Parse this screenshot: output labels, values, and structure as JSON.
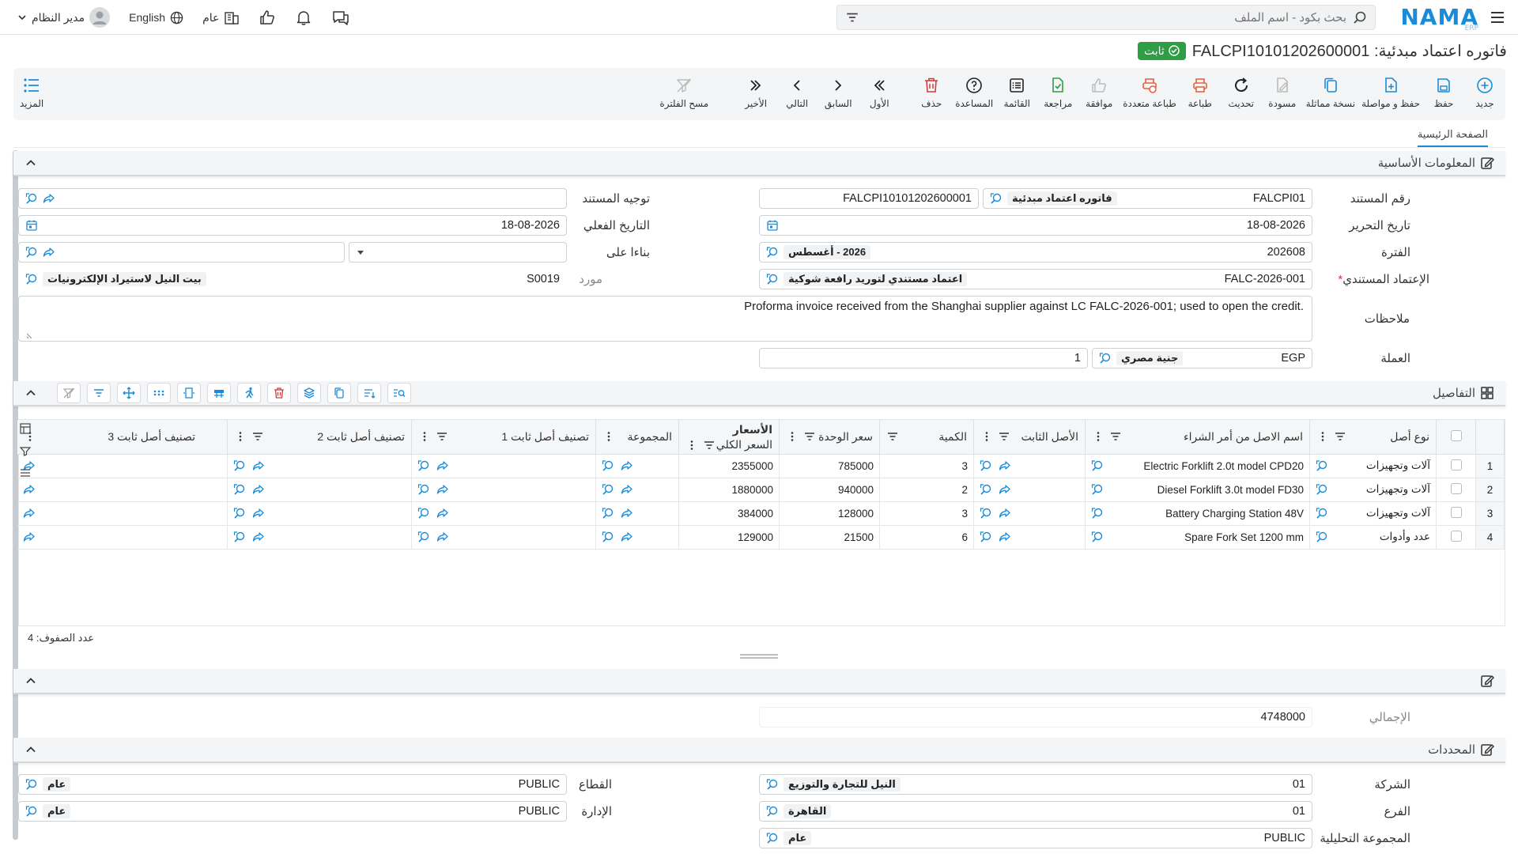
{
  "topbar": {
    "logo": "NAMA",
    "logo_sub": "ERP",
    "search_placeholder": "بحث بكود - اسم الملف",
    "user_name": "مدير النظام",
    "language": "English",
    "scope": "عام"
  },
  "title": {
    "text": "فاتوره اعتماد مبدئية: FALCPI10101202600001",
    "status": "ثابت"
  },
  "toolbar": [
    {
      "label": "جديد",
      "icon": "plus-circle-icon",
      "name": "new"
    },
    {
      "label": "حفظ",
      "icon": "save-icon",
      "name": "save"
    },
    {
      "label": "حفظ و مواصلة",
      "icon": "save-continue-icon",
      "name": "save-continue"
    },
    {
      "label": "نسخة مماثلة",
      "icon": "copy-icon",
      "name": "duplicate"
    },
    {
      "label": "مسودة",
      "icon": "draft-icon",
      "name": "draft"
    },
    {
      "label": "تحديث",
      "icon": "refresh-icon",
      "name": "refresh"
    },
    {
      "label": "طباعة",
      "icon": "print-icon",
      "name": "print"
    },
    {
      "label": "طباعة متعددة",
      "icon": "multi-print-icon",
      "name": "multi-print"
    },
    {
      "label": "موافقة",
      "icon": "thumbs-up-icon",
      "name": "approve"
    },
    {
      "label": "مراجعة",
      "icon": "review-icon",
      "name": "review"
    },
    {
      "label": "القائمة",
      "icon": "list-icon",
      "name": "list"
    },
    {
      "label": "المساعدة",
      "icon": "help-icon",
      "name": "help"
    },
    {
      "label": "حذف",
      "icon": "trash-icon",
      "name": "delete"
    },
    {
      "label": "الأول",
      "icon": "first-icon",
      "name": "first"
    },
    {
      "label": "السابق",
      "icon": "prev-icon",
      "name": "previous"
    },
    {
      "label": "التالي",
      "icon": "next-icon",
      "name": "next"
    },
    {
      "label": "الأخير",
      "icon": "last-icon",
      "name": "last"
    },
    {
      "label": "مسح الفلترة",
      "icon": "clear-filter-icon",
      "name": "clear-filter"
    }
  ],
  "toolbar_more": "المزيد",
  "tab": "الصفحة الرئيسية",
  "sections": {
    "basic": "المعلومات الأساسية",
    "details": "التفاصيل",
    "dimensions": "المحددات"
  },
  "form": {
    "doc_number_label": "رقم المستند",
    "doc_number": "FALCPI01",
    "doc_type_tag": "فاتوره اعتماد مبدئية",
    "doc_code": "FALCPI10101202600001",
    "doc_direction_label": "توجيه المستند",
    "edit_date_label": "تاريخ التحرير",
    "edit_date": "18-08-2026",
    "actual_date_label": "التاريخ الفعلي",
    "actual_date": "18-08-2026",
    "period_label": "الفترة",
    "period": "202608",
    "period_tag": "2026 - أغسطس",
    "based_on_label": "بناءا على",
    "lc_label": "الإعتماد المستندي",
    "lc_value": "FALC-2026-001",
    "lc_tag": "اعتماد مستندي لتوريد رافعة شوكية",
    "supplier_label": "مورد",
    "supplier_code": "S0019",
    "supplier_tag": "بيت النيل لاستيراد الإلكترونيات",
    "notes_label": "ملاحظات",
    "notes": "Proforma invoice received from the Shanghai supplier against LC FALC-2026-001; used to open the credit.",
    "currency_label": "العملة",
    "currency": "EGP",
    "currency_tag": "جنية مصري",
    "rate": "1"
  },
  "grid": {
    "headers": {
      "asset_type": "نوع أصل",
      "po_asset_name": "اسم الاصل من أمر الشراء",
      "fixed_asset": "الأصل الثابت",
      "qty": "الكمية",
      "prices_group": "الأسعار",
      "unit_price": "سعر الوحدة",
      "total_price": "السعر الكلي",
      "group": "المجموعة",
      "class1": "تصنيف أصل ثابت 1",
      "class2": "تصنيف أصل ثابت 2",
      "class3": "تصنيف أصل ثابت 3"
    },
    "rows": [
      {
        "num": "1",
        "type": "آلات وتجهيزات",
        "name": "Electric Forklift 2.0t model CPD20",
        "qty": "3",
        "unit": "785000",
        "total": "2355000"
      },
      {
        "num": "2",
        "type": "آلات وتجهيزات",
        "name": "Diesel Forklift 3.0t model FD30",
        "qty": "2",
        "unit": "940000",
        "total": "1880000"
      },
      {
        "num": "3",
        "type": "آلات وتجهيزات",
        "name": "Battery Charging Station 48V",
        "qty": "3",
        "unit": "128000",
        "total": "384000"
      },
      {
        "num": "4",
        "type": "عدد وأدوات",
        "name": "Spare Fork Set 1200 mm",
        "qty": "6",
        "unit": "21500",
        "total": "129000"
      }
    ],
    "row_count": "عدد الصفوف: 4"
  },
  "totals": {
    "total_label": "الإجمالي",
    "total": "4748000"
  },
  "dimensions": {
    "company_label": "الشركة",
    "company": "01",
    "company_tag": "النيل للتجارة والتوزيع",
    "sector_label": "القطاع",
    "sector": "PUBLIC",
    "sector_tag": "عام",
    "branch_label": "الفرع",
    "branch": "01",
    "branch_tag": "القاهرة",
    "admin_label": "الإدارة",
    "admin": "PUBLIC",
    "admin_tag": "عام",
    "analytic_label": "المجموعة التحليلية",
    "analytic": "PUBLIC",
    "analytic_tag": "عام"
  },
  "colors": {
    "accent": "#1a8bd8",
    "status_green": "#2e9e44",
    "danger": "#d33b3b",
    "orange": "#e8603c"
  }
}
